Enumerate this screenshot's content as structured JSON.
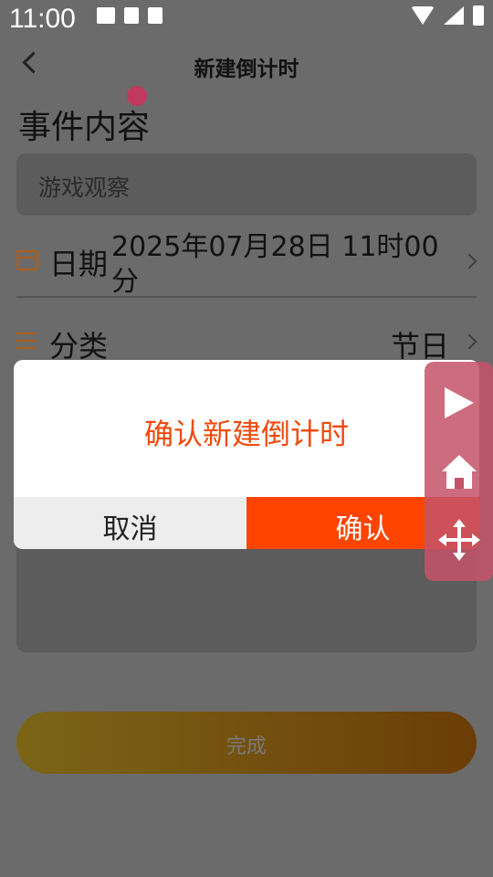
{
  "status_bar": {
    "time": "11:00",
    "left_icons": [
      "image-icon",
      "download-icon",
      "font-icon"
    ],
    "right_icons": [
      "wifi-icon",
      "signal-icon",
      "battery-icon"
    ]
  },
  "navbar": {
    "title": "新建倒计时"
  },
  "form": {
    "event_section_title": "事件内容",
    "event_value": "游戏观察",
    "date_label": "日期",
    "date_value": "2025年07月28日 11时00分",
    "category_label": "分类",
    "category_value": "节日"
  },
  "done_button": {
    "label": "完成"
  },
  "dialog": {
    "title": "确认新建倒计时",
    "cancel_label": "取消",
    "confirm_label": "确认"
  },
  "floating_toolbar": {
    "icons": [
      "play-icon",
      "home-icon",
      "move-icon"
    ]
  },
  "colors": {
    "accent": "#ff4400",
    "dialog_title": "#f04a0c",
    "overlay": "#6b6b6b",
    "float_bar": "#c55269"
  }
}
